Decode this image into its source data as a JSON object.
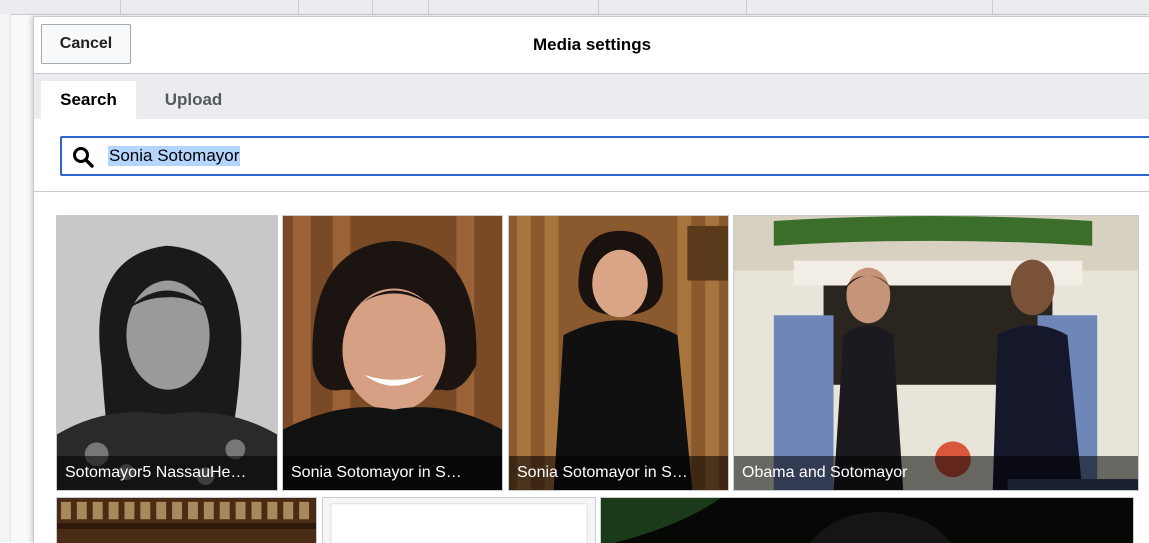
{
  "dialog": {
    "title": "Media settings",
    "cancel_label": "Cancel"
  },
  "tabs": [
    {
      "label": "Search",
      "active": true
    },
    {
      "label": "Upload",
      "active": false
    }
  ],
  "search": {
    "value": "Sonia Sotomayor",
    "icon": "search-icon"
  },
  "results": [
    {
      "caption": "Sotomayor5 NassauHe…"
    },
    {
      "caption": "Sonia Sotomayor in S…"
    },
    {
      "caption": "Sonia Sotomayor in S…"
    },
    {
      "caption": "Obama and Sotomayor"
    }
  ],
  "colors": {
    "accent": "#3366cc",
    "selection": "#b4d5fe",
    "tabbar": "#eaecf0"
  }
}
